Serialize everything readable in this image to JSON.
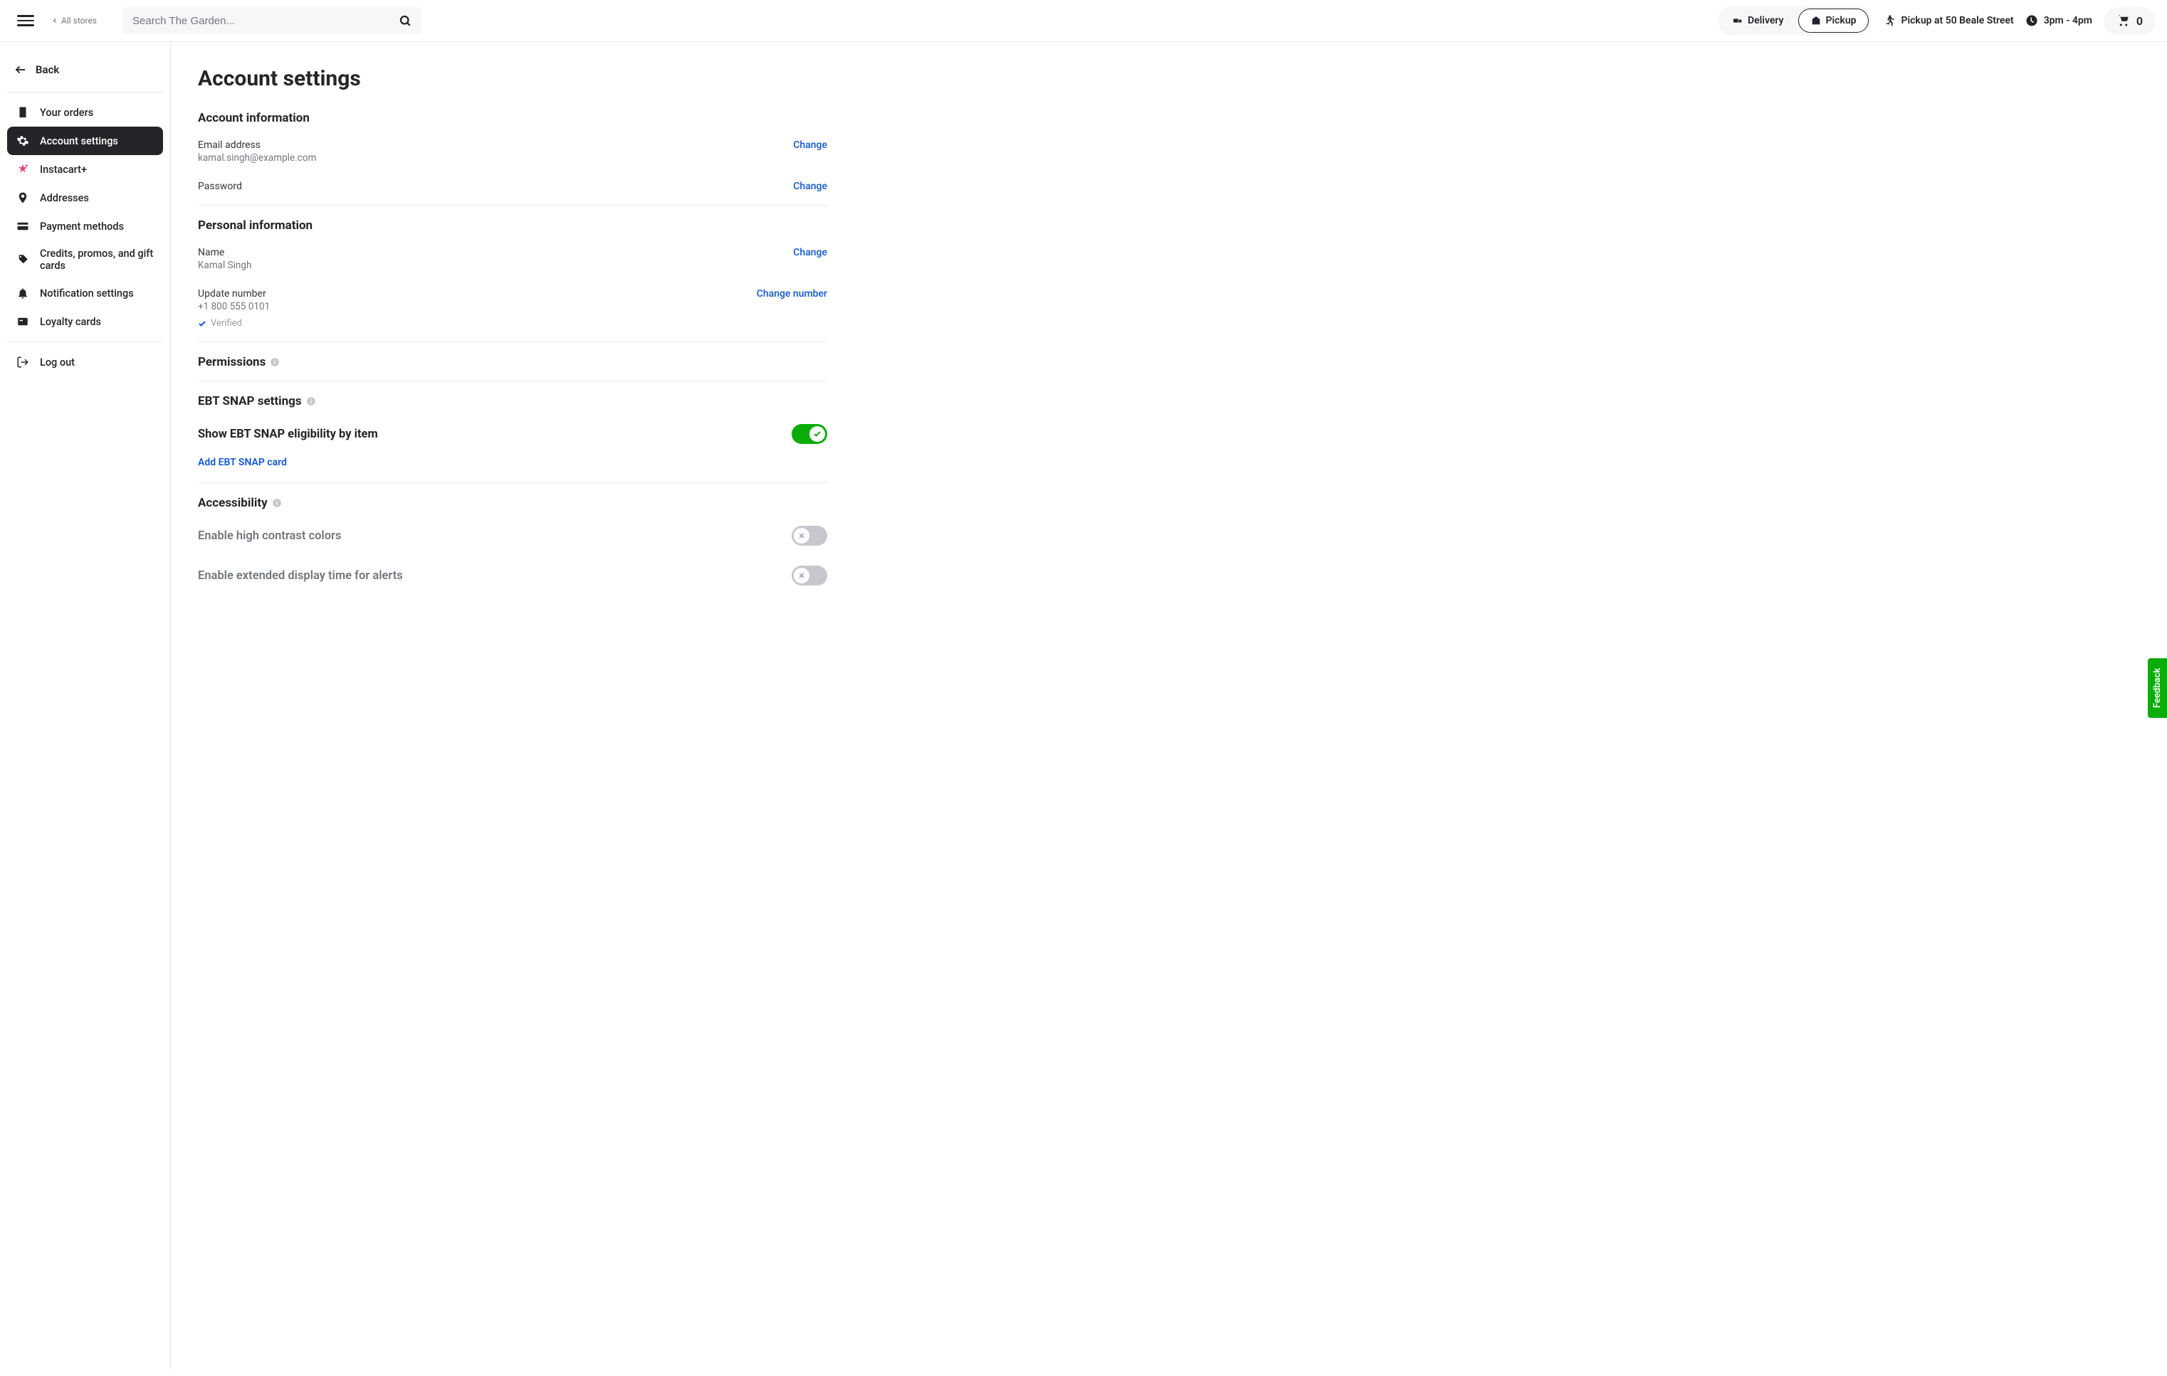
{
  "header": {
    "all_stores": "All stores",
    "search_placeholder": "Search The Garden...",
    "delivery": "Delivery",
    "pickup": "Pickup",
    "location": "Pickup at 50 Beale Street",
    "time": "3pm - 4pm",
    "cart_count": "0"
  },
  "sidebar": {
    "back": "Back",
    "items": [
      {
        "label": "Your orders"
      },
      {
        "label": "Account settings"
      },
      {
        "label": "Instacart+"
      },
      {
        "label": "Addresses"
      },
      {
        "label": "Payment methods"
      },
      {
        "label": "Credits, promos, and gift cards"
      },
      {
        "label": "Notification settings"
      },
      {
        "label": "Loyalty cards"
      }
    ],
    "logout": "Log out"
  },
  "page": {
    "title": "Account settings",
    "account_info_heading": "Account information",
    "email_label": "Email address",
    "email_value": "kamal.singh@example.com",
    "password_label": "Password",
    "change": "Change",
    "personal_info_heading": "Personal information",
    "name_label": "Name",
    "name_value": "Kamal Singh",
    "phone_label": "Update number",
    "phone_value": "+1 800 555 0101",
    "change_number": "Change number",
    "verified": "Verified",
    "permissions_heading": "Permissions",
    "ebt_heading": "EBT SNAP settings",
    "ebt_show_label": "Show EBT SNAP eligibility by item",
    "add_ebt": "Add EBT SNAP card",
    "accessibility_heading": "Accessibility",
    "high_contrast_label": "Enable high contrast colors",
    "extended_display_label": "Enable extended display time for alerts"
  },
  "feedback": "Feedback"
}
